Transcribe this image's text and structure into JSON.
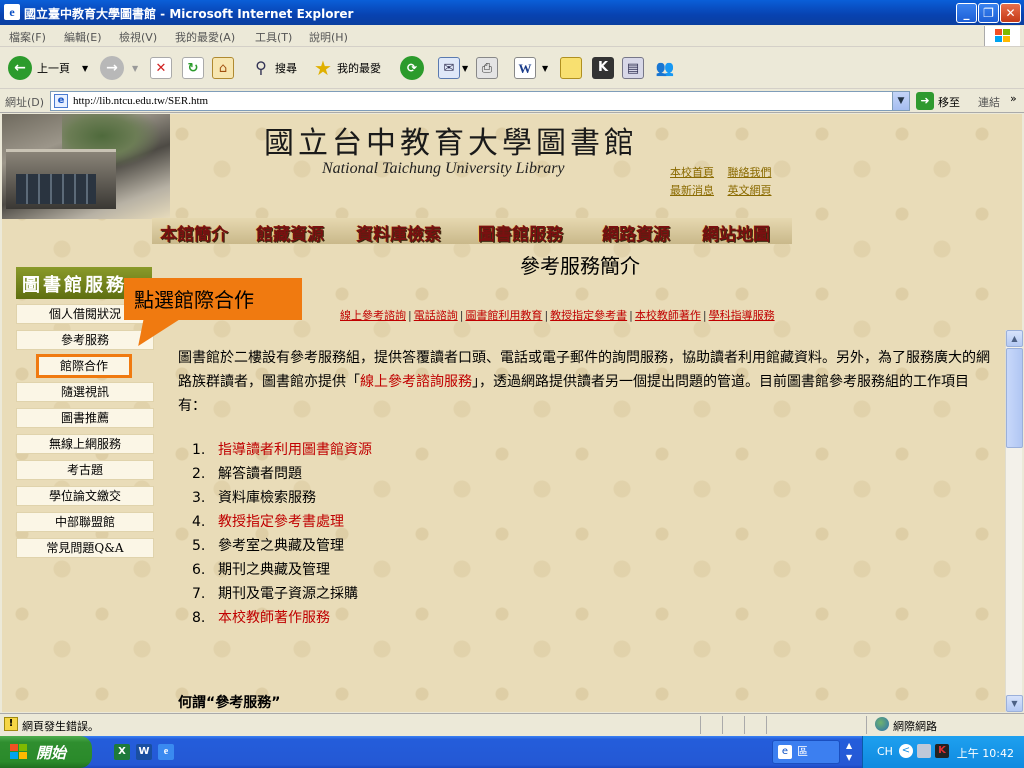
{
  "window": {
    "title": "國立臺中教育大學圖書館 - Microsoft Internet Explorer"
  },
  "menubar": {
    "items": [
      "檔案(F)",
      "編輯(E)",
      "檢視(V)",
      "我的最愛(A)",
      "工具(T)",
      "說明(H)"
    ]
  },
  "toolbar": {
    "back_label": "上一頁",
    "search_label": "搜尋",
    "favorites_label": "我的最愛"
  },
  "address": {
    "label": "網址(D)",
    "url": "http://lib.ntcu.edu.tw/SER.htm",
    "go_label": "移至",
    "links_label": "連結"
  },
  "site": {
    "title": "國立台中教育大學圖書館",
    "subtitle": "National Taichung University Library",
    "top_links": [
      "本校首頁",
      "聯絡我們",
      "最新消息",
      "英文網頁"
    ],
    "main_nav": [
      "本館簡介",
      "館藏資源",
      "資料庫檢索",
      "圖書館服務",
      "網路資源",
      "網站地圖"
    ]
  },
  "sidebar": {
    "heading": "圖書館服務",
    "items": [
      "個人借閱狀況",
      "參考服務",
      "館際合作",
      "隨選視訊",
      "圖書推薦",
      "無線上網服務",
      "考古題",
      "學位論文繳交",
      "中部聯盟館",
      "常見問題Q&A"
    ]
  },
  "callout": {
    "text": "點選館際合作"
  },
  "content": {
    "heading": "參考服務簡介",
    "sub_links": [
      "線上參考諮詢",
      "電話諮詢",
      "圖書館利用教育",
      "教授指定參考書",
      "本校教師著作",
      "學科指導服務"
    ],
    "intro_1": "圖書館於二樓設有參考服務組，提供答覆讀者口頭、電話或電子郵件的詢問服務，協助讀者利用館藏資料。另外，為了服務廣大的網路族群讀者，圖書館亦提供「",
    "intro_link": "線上參考諮詢服務",
    "intro_2": "」，透過網路提供讀者另一個提出問題的管道。目前圖書館參考服務組的工作項目有：",
    "list": [
      {
        "num": "1.",
        "text": "指導讀者利用圖書館資源",
        "link": true
      },
      {
        "num": "2.",
        "text": "解答讀者問題",
        "link": false
      },
      {
        "num": "3.",
        "text": "資料庫檢索服務",
        "link": false
      },
      {
        "num": "4.",
        "text": "教授指定參考書處理",
        "link": true
      },
      {
        "num": "5.",
        "text": "參考室之典藏及管理",
        "link": false
      },
      {
        "num": "6.",
        "text": "期刊之典藏及管理",
        "link": false
      },
      {
        "num": "7.",
        "text": "期刊及電子資源之採購",
        "link": false
      },
      {
        "num": "8.",
        "text": "本校教師著作服務",
        "link": true
      }
    ],
    "what_heading": "何謂“參考服務”"
  },
  "status": {
    "text": "網頁發生錯誤。",
    "zone": "網際網路"
  },
  "taskbar": {
    "start_label": "開始",
    "task_label": "區",
    "ime": "CH",
    "clock": "上午 10:42"
  },
  "colors": {
    "link_red": "#c00000",
    "callout_orange": "#f07a10",
    "nav_dark_red": "#7a1010"
  }
}
